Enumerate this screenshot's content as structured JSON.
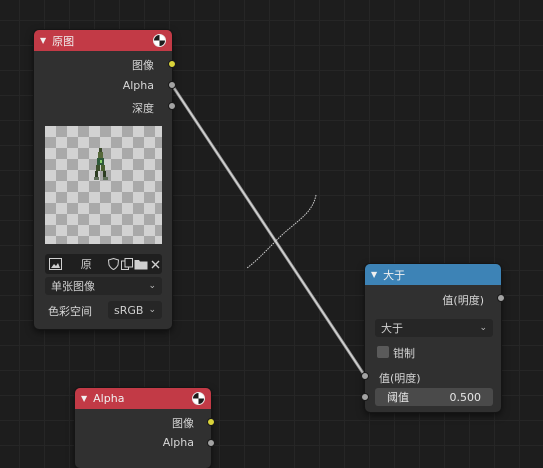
{
  "nodes": {
    "image_node": {
      "title": "原图",
      "outputs": [
        "图像",
        "Alpha",
        "深度"
      ],
      "image_name": "原",
      "source_mode": "单张图像",
      "color_space_label": "色彩空间",
      "color_space_value": "sRGB"
    },
    "compare_node": {
      "title": "大于",
      "output_label": "值(明度)",
      "operation": "大于",
      "clamp_label": "钳制",
      "input_label": "值(明度)",
      "threshold_label": "阈值",
      "threshold_value": "0.500"
    },
    "alpha_node": {
      "title": "Alpha",
      "outputs": [
        "图像",
        "Alpha"
      ]
    }
  },
  "colors": {
    "header_image": "#c23a46",
    "header_math": "#3d83b6",
    "socket_color": "#d9d33a",
    "socket_value": "#a3a3a3",
    "background": "#1d1d1d",
    "node_body": "#303030"
  }
}
